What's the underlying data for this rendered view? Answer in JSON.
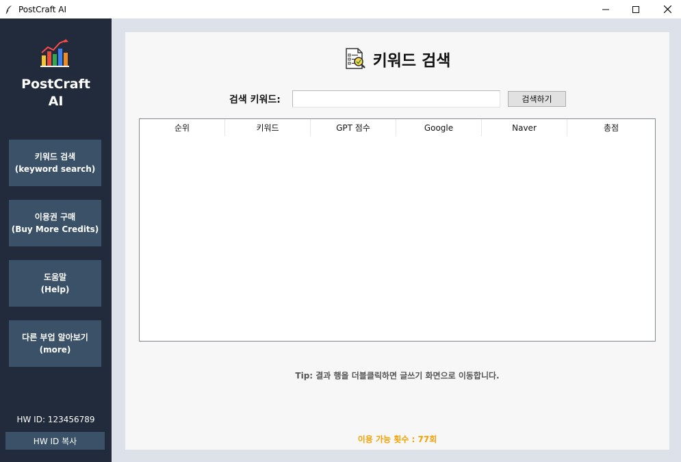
{
  "window": {
    "title": "PostCraft AI",
    "controls": [
      "minimize",
      "maximize",
      "close"
    ]
  },
  "sidebar": {
    "brand_line1": "PostCraft",
    "brand_line2": "AI",
    "logo_icon": "bar-chart-trend-icon",
    "nav": [
      {
        "line1": "키워드 검색",
        "line2": "(keyword search)"
      },
      {
        "line1": "이용권 구매",
        "line2": "(Buy More Credits)"
      },
      {
        "line1": "도움말",
        "line2": "(Help)"
      },
      {
        "line1": "다른 부업 알아보기",
        "line2": "(more)"
      }
    ],
    "hwid_label": "HW ID:  123456789",
    "hwid_copy": "HW ID 복사"
  },
  "main": {
    "heading": "키워드 검색",
    "heading_icon": "document-search-icon",
    "search_label": "검색 키워드:",
    "search_value": "",
    "search_button": "검색하기",
    "columns": [
      "순위",
      "키워드",
      "GPT 점수",
      "Google",
      "Naver",
      "총점"
    ],
    "rows": [],
    "tip": "Tip: 결과 행을 더블클릭하면 글쓰기 화면으로 이동합니다.",
    "credits": "이용 가능 횟수 : 77회"
  },
  "colors": {
    "sidebar_bg": "#212b3b",
    "nav_button_bg": "#3a5168",
    "credits_text": "#f5a000",
    "content_bg": "#f7f7f7",
    "outer_bg": "#dde2ea"
  }
}
